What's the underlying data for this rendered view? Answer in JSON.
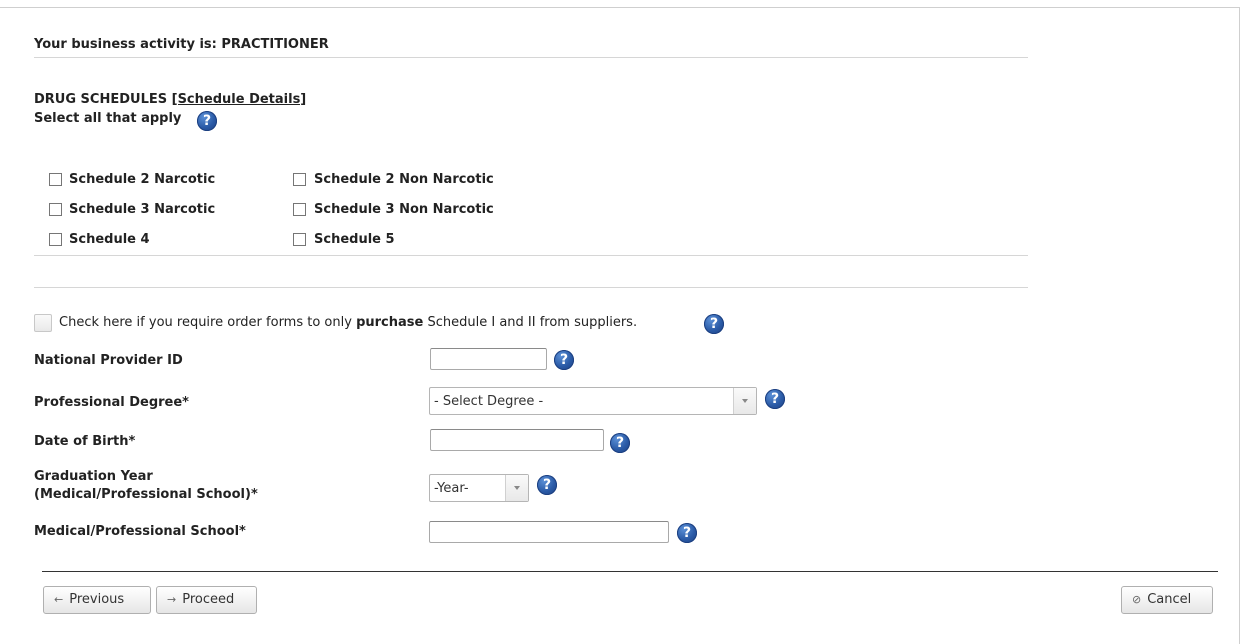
{
  "business": {
    "label": "Your business activity is: PRACTITIONER"
  },
  "schedules": {
    "heading": "DRUG SCHEDULES",
    "details_link": "[Schedule Details]",
    "select_all": "Select all that apply",
    "options": [
      {
        "label": "Schedule 2 Narcotic",
        "checked": false
      },
      {
        "label": "Schedule 2 Non Narcotic",
        "checked": false
      },
      {
        "label": "Schedule 3 Narcotic",
        "checked": false
      },
      {
        "label": "Schedule 3 Non Narcotic",
        "checked": false
      },
      {
        "label": "Schedule 4",
        "checked": false
      },
      {
        "label": "Schedule 5",
        "checked": false
      }
    ]
  },
  "order_forms": {
    "text_before": "Check here if you require order forms to only ",
    "text_bold": "purchase",
    "text_after": " Schedule I and II from suppliers.",
    "checked": false
  },
  "fields": {
    "npi_label": "National Provider ID",
    "npi_value": "",
    "degree_label": "Professional Degree*",
    "degree_value": "- Select Degree -",
    "dob_label": "Date of Birth*",
    "dob_value": "",
    "grad_label_1": "Graduation Year",
    "grad_label_2": "(Medical/Professional School)*",
    "grad_value": "-Year-",
    "school_label": "Medical/Professional School*",
    "school_value": ""
  },
  "buttons": {
    "previous": "Previous",
    "proceed": "Proceed",
    "cancel": "Cancel"
  },
  "icons": {
    "help": "help-question-icon",
    "previous": "arrow-left-icon",
    "proceed": "arrow-right-icon",
    "cancel": "cancel-circle-icon"
  },
  "colors": {
    "help_icon": "#2a5aa6",
    "border": "#d6d6d6"
  }
}
